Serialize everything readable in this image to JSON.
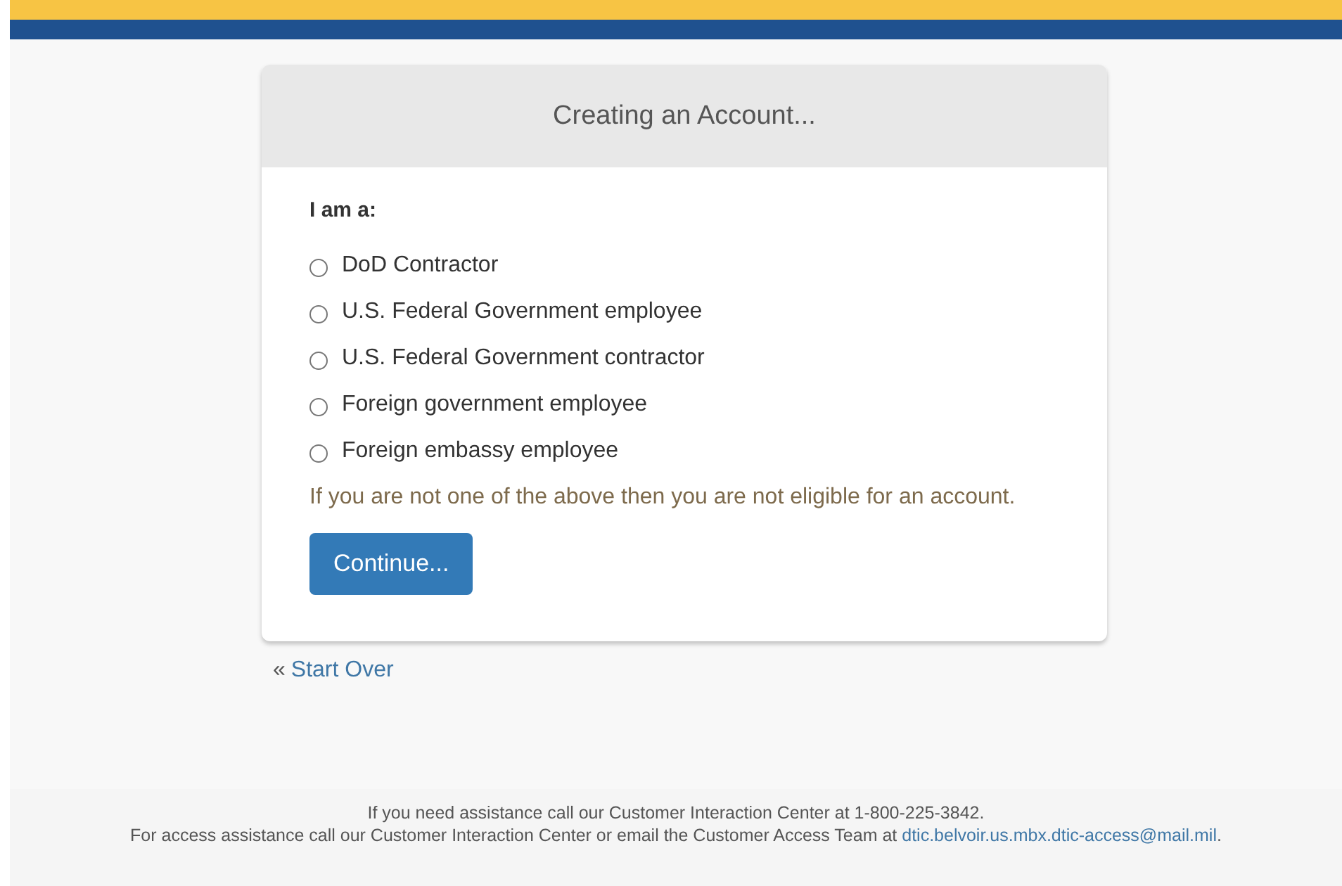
{
  "card": {
    "title": "Creating an Account...",
    "question": "I am a:",
    "options": [
      {
        "label": "DoD Contractor",
        "selected": false
      },
      {
        "label": "U.S. Federal Government employee",
        "selected": false
      },
      {
        "label": "U.S. Federal Government contractor",
        "selected": false
      },
      {
        "label": "Foreign government employee",
        "selected": false
      },
      {
        "label": "Foreign embassy employee",
        "selected": false
      }
    ],
    "notice": "If you are not one of the above then you are not eligible for an account.",
    "button": "Continue..."
  },
  "back": {
    "mark": "«",
    "link": "Start Over"
  },
  "footer": {
    "line1": "If you need assistance call our Customer Interaction Center at 1-800-225-3842.",
    "line2": "For access assistance call our Customer Interaction Center or email the Customer Access Team at",
    "email": "dtic.belvoir.us.mbx.dtic-access@mail.mil",
    "end": "."
  }
}
